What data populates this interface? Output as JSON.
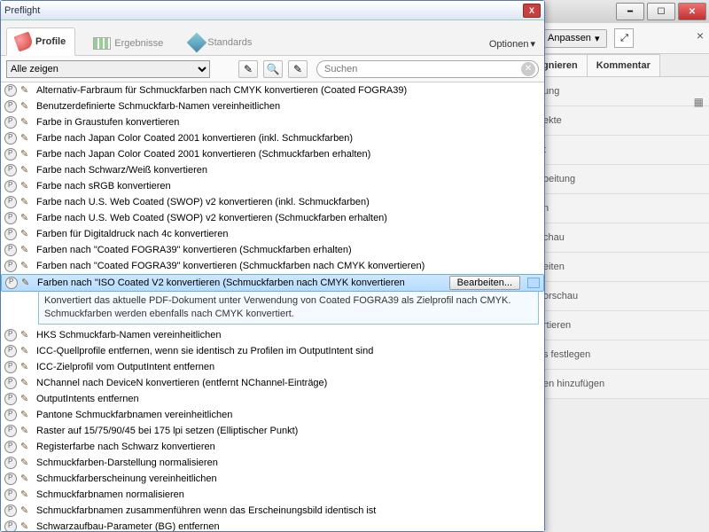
{
  "dialog": {
    "title": "Preflight",
    "tabs": {
      "profile": "Profile",
      "results": "Ergebnisse",
      "standards": "Standards",
      "options": "Optionen"
    },
    "filter": {
      "show_all": "Alle zeigen"
    },
    "search": {
      "placeholder": "Suchen"
    },
    "edit_button": "Bearbeiten...",
    "items": [
      "Alternativ-Farbraum für Schmuckfarben nach CMYK konvertieren (Coated FOGRA39)",
      "Benutzerdefinierte Schmuckfarb-Namen vereinheitlichen",
      "Farbe in Graustufen konvertieren",
      "Farbe nach Japan Color Coated 2001 konvertieren (inkl. Schmuckfarben)",
      "Farbe nach Japan Color Coated 2001 konvertieren (Schmuckfarben erhalten)",
      "Farbe nach Schwarz/Weiß konvertieren",
      "Farbe nach sRGB konvertieren",
      "Farbe nach U.S. Web Coated (SWOP) v2 konvertieren (inkl. Schmuckfarben)",
      "Farbe nach U.S. Web Coated (SWOP) v2 konvertieren (Schmuckfarben erhalten)",
      "Farben für Digitaldruck nach 4c konvertieren",
      "Farben nach \"Coated FOGRA39\" konvertieren (Schmuckfarben erhalten)",
      "Farben nach \"Coated FOGRA39\" konvertieren (Schmuckfarben nach CMYK konvertieren)",
      "Farben nach \"ISO Coated V2 konvertieren (Schmuckfarben nach CMYK konvertieren",
      "HKS Schmuckfarb-Namen vereinheitlichen",
      "ICC-Quellprofile entfernen, wenn sie identisch zu Profilen im OutputIntent sind",
      "ICC-Zielprofil vom OutputIntent entfernen",
      "NChannel nach DeviceN konvertieren (entfernt NChannel-Einträge)",
      "OutputIntents entfernen",
      "Pantone Schmuckfarbnamen vereinheitlichen",
      "Raster auf 15/75/90/45 bei 175 lpi setzen (Elliptischer Punkt)",
      "Registerfarbe nach Schwarz konvertieren",
      "Schmuckfarben-Darstellung normalisieren",
      "Schmuckfarberscheinung vereinheitlichen",
      "Schmuckfarbnamen normalisieren",
      "Schmuckfarbnamen zusammenführen wenn das Erscheinungsbild identisch ist",
      "Schwarzaufbau-Parameter (BG) entfernen"
    ],
    "selected_index": 12,
    "description": "Konvertiert das aktuelle PDF-Dokument unter Verwendung von Coated FOGRA39 als Zielprofil nach CMYK. Schmuckfarben werden ebenfalls nach CMYK konvertiert."
  },
  "bg": {
    "customize": "Anpassen",
    "tabs": {
      "sign": "gnieren",
      "comment": "Kommentar"
    },
    "sections": [
      "ung",
      "ekte",
      "t",
      "beitung",
      "n",
      "chau",
      "eiten",
      "orschau",
      "rtieren",
      "s festlegen",
      "en hinzufügen"
    ]
  }
}
